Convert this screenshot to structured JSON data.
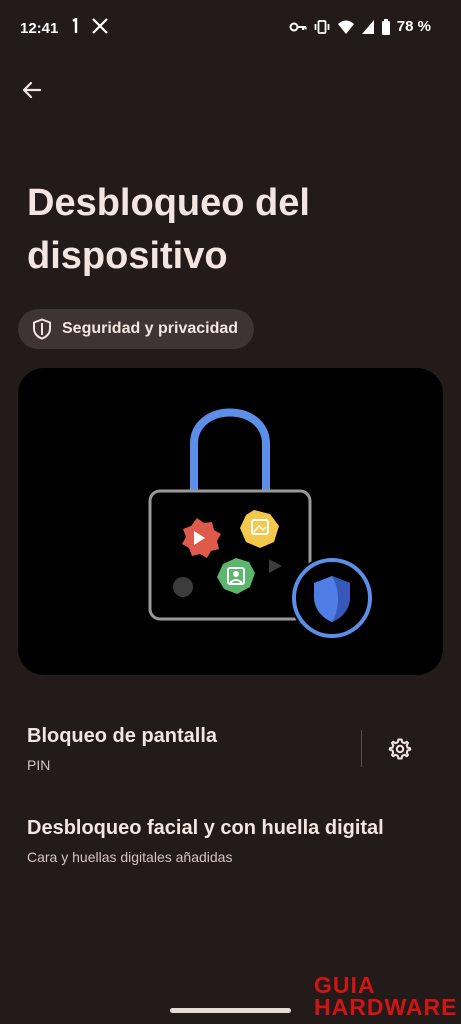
{
  "status_bar": {
    "time": "12:41",
    "left_icons": [
      "notification-digit-icon",
      "x-app-icon"
    ],
    "right_icons": [
      "key-icon",
      "vibrate-icon",
      "wifi-icon",
      "signal-icon",
      "battery-icon"
    ],
    "battery": "78 %"
  },
  "header": {
    "title": "Desbloqueo del dispositivo"
  },
  "chip": {
    "label": "Seguridad y privacidad"
  },
  "preferences": [
    {
      "title": "Bloqueo de pantalla",
      "summary": "PIN"
    },
    {
      "title": "Desbloqueo facial y con huella digital",
      "summary": "Cara y huellas digitales añadidas"
    }
  ],
  "watermark": {
    "line1": "GUIA",
    "line2": "HARDWARE"
  },
  "colors": {
    "background": "#221b1a",
    "chip_background": "#3d3433",
    "lock_shackle": "#5b8fe8",
    "lock_body_outline": "#9a9a9a",
    "badge_red": "#e05a4c",
    "badge_yellow": "#f4c84c",
    "badge_green": "#5cb66e",
    "shield_blue": "#4f7ee6",
    "watermark": "#d11414"
  }
}
